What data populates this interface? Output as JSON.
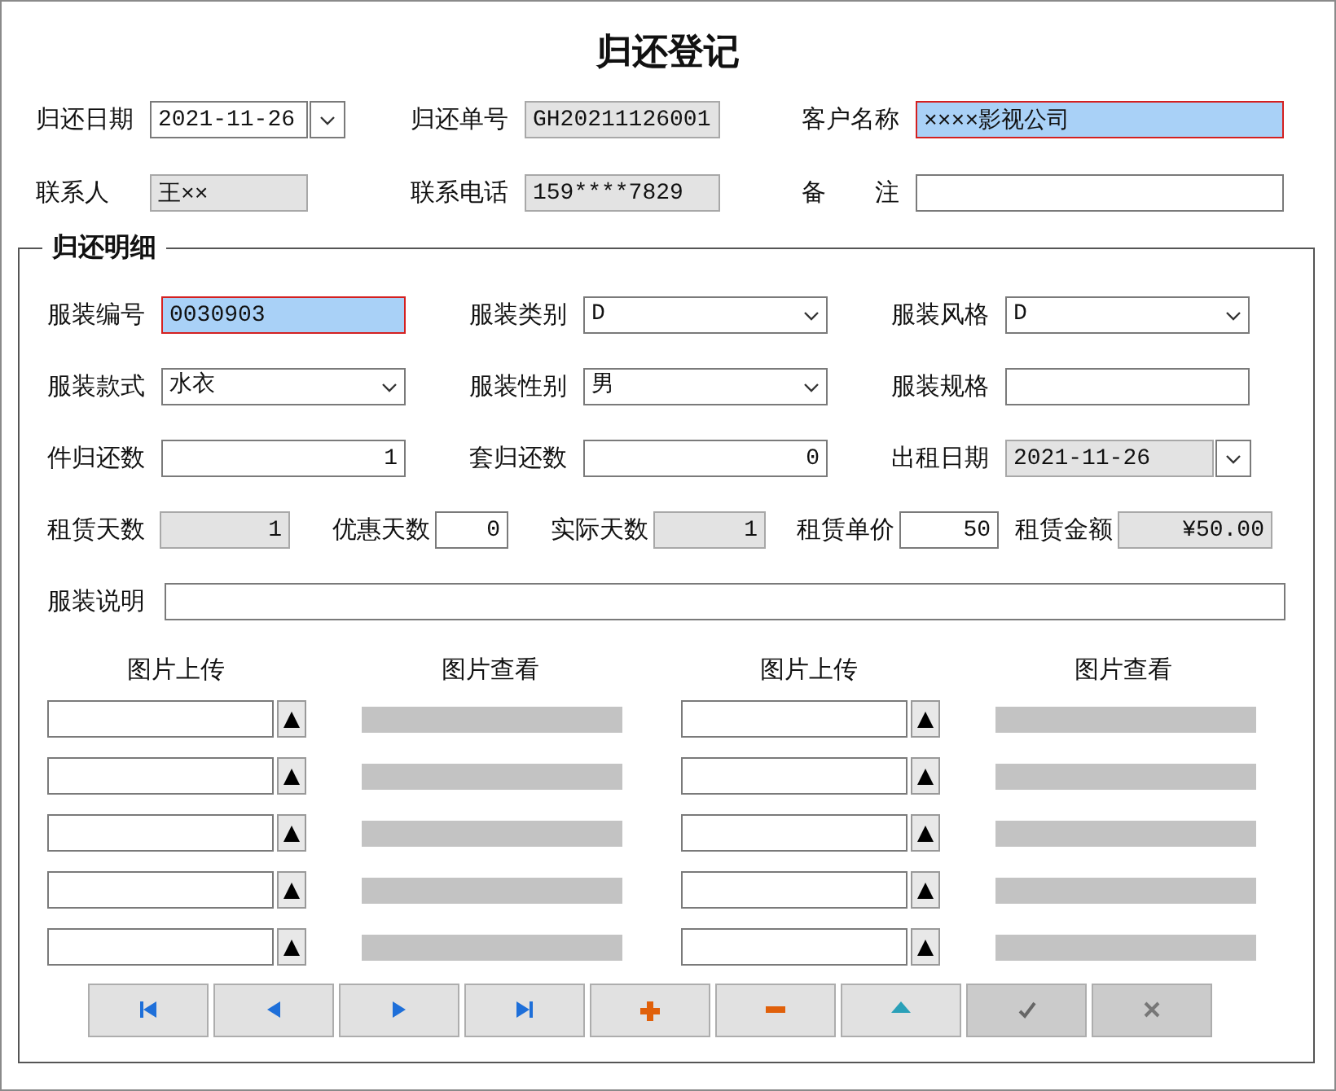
{
  "title": "归还登记",
  "header_rows": [
    [
      {
        "label": "归还日期",
        "kind": "date",
        "value": "2021-11-26",
        "readonly": false,
        "focused": false
      },
      {
        "label": "归还单号",
        "kind": "text",
        "value": "GH20211126001",
        "readonly": true,
        "focused": false
      },
      {
        "label": "客户名称",
        "kind": "text",
        "value": "××××影视公司",
        "readonly": false,
        "focused": true
      }
    ],
    [
      {
        "label": "联系人",
        "kind": "text",
        "value": "王××",
        "readonly": true,
        "focused": false
      },
      {
        "label": "联系电话",
        "kind": "text",
        "value": "159****7829",
        "readonly": true,
        "focused": false
      },
      {
        "label": "备　　注",
        "kind": "text",
        "readonly": false,
        "focused": false
      }
    ]
  ],
  "detail": {
    "legend": "归还明细",
    "rows": [
      [
        {
          "label": "服装编号",
          "kind": "text",
          "value": "0030903",
          "readonly": false,
          "focused": true
        },
        {
          "label": "服装类别",
          "kind": "select",
          "value": "D",
          "readonly": false,
          "focused": false
        },
        {
          "label": "服装风格",
          "kind": "select",
          "value": "D",
          "readonly": false,
          "focused": false
        }
      ],
      [
        {
          "label": "服装款式",
          "kind": "select",
          "value": "水衣",
          "readonly": false,
          "focused": false
        },
        {
          "label": "服装性别",
          "kind": "select",
          "value": "男",
          "readonly": false,
          "focused": false
        },
        {
          "label": "服装规格",
          "kind": "text",
          "readonly": false,
          "focused": false
        }
      ],
      [
        {
          "label": "件归还数",
          "kind": "number",
          "value": "1",
          "readonly": false,
          "focused": false
        },
        {
          "label": "套归还数",
          "kind": "number",
          "value": "0",
          "readonly": false,
          "focused": false
        },
        {
          "label": "出租日期",
          "kind": "date",
          "value": "2021-11-26",
          "readonly": true,
          "focused": false
        }
      ],
      [
        {
          "label": "租赁天数",
          "kind": "number",
          "value": "1",
          "readonly": true,
          "focused": false
        },
        {
          "label": "优惠天数",
          "kind": "number",
          "value": "0",
          "readonly": false,
          "focused": false
        },
        {
          "label": "实际天数",
          "kind": "number",
          "value": "1",
          "readonly": true,
          "focused": false
        },
        {
          "label": "租赁单价",
          "kind": "number",
          "value": "50",
          "readonly": false,
          "focused": false
        },
        {
          "label": "租赁金额",
          "kind": "number",
          "value": "¥50.00",
          "readonly": true,
          "focused": false
        }
      ],
      [
        {
          "label": "服装说明",
          "kind": "text",
          "readonly": false,
          "focused": false
        }
      ]
    ],
    "picture_columns": [
      {
        "upload_header": "图片上传",
        "view_header": "图片查看"
      },
      {
        "upload_header": "图片上传",
        "view_header": "图片查看"
      }
    ]
  },
  "toolbar": [
    {
      "kind": "first",
      "disabled": false
    },
    {
      "kind": "prev",
      "disabled": false
    },
    {
      "kind": "next",
      "disabled": false
    },
    {
      "kind": "last",
      "disabled": false
    },
    {
      "kind": "add",
      "disabled": false
    },
    {
      "kind": "delete",
      "disabled": false
    },
    {
      "kind": "up",
      "disabled": false
    },
    {
      "kind": "save",
      "disabled": true
    },
    {
      "kind": "cancel",
      "disabled": true
    }
  ]
}
